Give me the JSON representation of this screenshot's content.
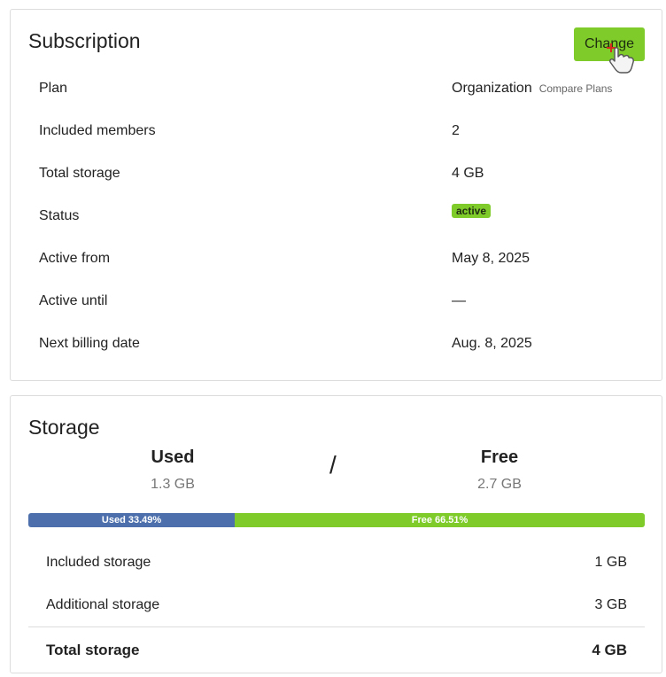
{
  "subscription": {
    "title": "Subscription",
    "change_label": "Change",
    "rows": [
      {
        "label": "Plan",
        "value": "Organization",
        "link": "Compare Plans"
      },
      {
        "label": "Included members",
        "value": "2"
      },
      {
        "label": "Total storage",
        "value": "4 GB"
      },
      {
        "label": "Status",
        "value": "active"
      },
      {
        "label": "Active from",
        "value": "May 8, 2025"
      },
      {
        "label": "Active until",
        "value": "—"
      },
      {
        "label": "Next billing date",
        "value": "Aug. 8, 2025"
      }
    ]
  },
  "storage": {
    "title": "Storage",
    "used_label": "Used",
    "used_value": "1.3 GB",
    "separator": "/",
    "free_label": "Free",
    "free_value": "2.7 GB",
    "bar": {
      "used_text": "Used 33.49%",
      "used_percent": 33.49,
      "free_text": "Free 66.51%",
      "free_percent": 66.51
    },
    "rows": [
      {
        "label": "Included storage",
        "value": "1 GB"
      },
      {
        "label": "Additional storage",
        "value": "3 GB"
      }
    ],
    "total": {
      "label": "Total storage",
      "value": "4 GB"
    }
  },
  "colors": {
    "accent_green": "#7ecb2a",
    "used_blue": "#4d70ad"
  },
  "icons": {
    "cursor": "hand-pointer-icon"
  }
}
